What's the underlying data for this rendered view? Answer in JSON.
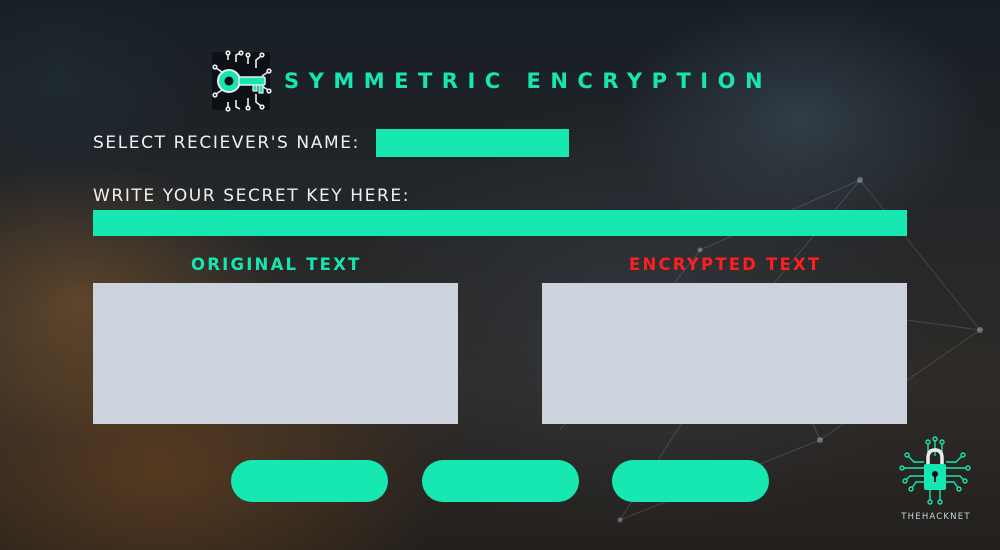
{
  "header": {
    "title": "SYMMETRIC ENCRYPTION",
    "icon": "key-circuit-icon"
  },
  "form": {
    "receiver_label": "SELECT RECIEVER'S NAME:",
    "receiver_value": "",
    "key_label": "WRITE YOUR SECRET KEY HERE:",
    "key_value": ""
  },
  "panels": {
    "original_label": "ORIGINAL TEXT",
    "original_value": "",
    "encrypted_label": "ENCRYPTED TEXT",
    "encrypted_value": ""
  },
  "buttons": [
    {
      "label": ""
    },
    {
      "label": ""
    },
    {
      "label": ""
    }
  ],
  "brand": {
    "name": "THEHACKNET",
    "icon": "padlock-circuit-icon"
  },
  "colors": {
    "accent": "#16e6b2",
    "encrypted_label": "#ff1f1f",
    "text_box": "#ccd3dd"
  }
}
